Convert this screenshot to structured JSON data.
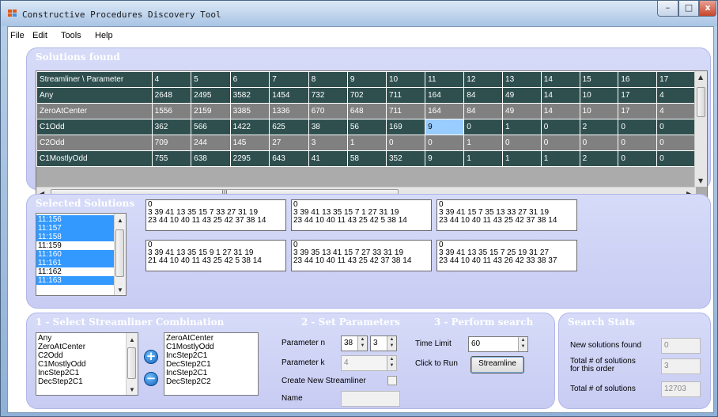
{
  "window": {
    "title": "Constructive Procedures Discovery Tool",
    "minimize_glyph": "–",
    "maximize_glyph": "□",
    "close_glyph": "x"
  },
  "menu": [
    "File",
    "Edit",
    "Tools",
    "Help"
  ],
  "solutions_found": {
    "title": "Solutions found",
    "corner_header": "Streamliner \\ Parameter",
    "columns": [
      "4",
      "5",
      "6",
      "7",
      "8",
      "9",
      "10",
      "11",
      "12",
      "13",
      "14",
      "15",
      "16",
      "17"
    ],
    "rows": [
      {
        "name": "Any",
        "style": "dark",
        "values": [
          "2648",
          "2495",
          "3582",
          "1454",
          "732",
          "702",
          "711",
          "164",
          "84",
          "49",
          "14",
          "10",
          "17",
          "4"
        ]
      },
      {
        "name": "ZeroAtCenter",
        "style": "gray",
        "values": [
          "1556",
          "2159",
          "3385",
          "1336",
          "670",
          "648",
          "711",
          "164",
          "84",
          "49",
          "14",
          "10",
          "17",
          "4"
        ]
      },
      {
        "name": "C1Odd",
        "style": "dark",
        "values": [
          "362",
          "566",
          "1422",
          "625",
          "38",
          "56",
          "169",
          "9",
          "0",
          "1",
          "0",
          "2",
          "0",
          "0"
        ]
      },
      {
        "name": "C2Odd",
        "style": "gray",
        "values": [
          "709",
          "244",
          "145",
          "27",
          "3",
          "1",
          "0",
          "0",
          "1",
          "0",
          "0",
          "0",
          "0",
          "0"
        ]
      },
      {
        "name": "C1MostlyOdd",
        "style": "dark",
        "values": [
          "755",
          "638",
          "2295",
          "643",
          "41",
          "58",
          "352",
          "9",
          "1",
          "1",
          "1",
          "2",
          "0",
          "0"
        ]
      }
    ],
    "selected_cell": {
      "row": 2,
      "col": 7
    },
    "hscroll_grip": "III"
  },
  "selected_solutions": {
    "title": "Selected Solutions",
    "list": [
      {
        "label": "11:156",
        "selected": true
      },
      {
        "label": "11:157",
        "selected": true
      },
      {
        "label": "11:158",
        "selected": true
      },
      {
        "label": "11:159",
        "selected": false
      },
      {
        "label": "11:160",
        "selected": true
      },
      {
        "label": "11:161",
        "selected": true
      },
      {
        "label": "11:162",
        "selected": false
      },
      {
        "label": "11:163",
        "selected": true
      }
    ],
    "boxes": [
      "0\n3 39 41 13 35 15 7 33 27 31 19\n23 44 10 40 11 43 25 42 37 38 14",
      "0\n3 39 41 13 35 15 7 1 27 31 19\n23 44 10 40 11 43 25 42 5 38 14",
      "0\n3 39 41 15 7 35 13 33 27 31 19\n23 44 10 40 11 43 25 42 37 38 14",
      "0\n3 39 41 13 35 15 9 1 27 31 19\n21 44 10 40 11 43 25 42 5 38 14",
      "0\n3 39 35 13 41 15 7 27 33 31 19\n23 44 10 40 11 43 25 42 37 38 14",
      "0\n3 39 41 13 35 15 7 25 19 31 27\n23 44 10 40 11 43 26 42 33 38 37"
    ]
  },
  "streamliner": {
    "title": "1 - Select Streamliner Combination",
    "available": [
      "Any",
      "ZeroAtCenter",
      "C2Odd",
      "C1MostlyOdd",
      "IncStep2C1",
      "DecStep2C1"
    ],
    "chosen": [
      "ZeroAtCenter",
      "C1MostlyOdd",
      "IncStep2C1",
      "DecStep2C1",
      "IncStep2C1",
      "DecStep2C2"
    ],
    "add_glyph": "+",
    "remove_glyph": "−"
  },
  "parameters": {
    "title": "2 - Set Parameters",
    "n_label": "Parameter n",
    "n_value": "38",
    "n_second": "3",
    "k_label": "Parameter k",
    "k_value": "4",
    "create_label": "Create New Streamliner",
    "name_label": "Name",
    "name_value": ""
  },
  "search": {
    "title": "3 - Perform search",
    "time_label": "Time Limit",
    "time_value": "60",
    "run_label": "Click to Run",
    "run_button": "Streamline"
  },
  "stats": {
    "title": "Search Stats",
    "new_label": "New solutions found",
    "new_value": "0",
    "order_label": "Total # of solutions\nfor this order",
    "order_value": "3",
    "total_label": "Total # of solutions",
    "total_value": "12703"
  }
}
